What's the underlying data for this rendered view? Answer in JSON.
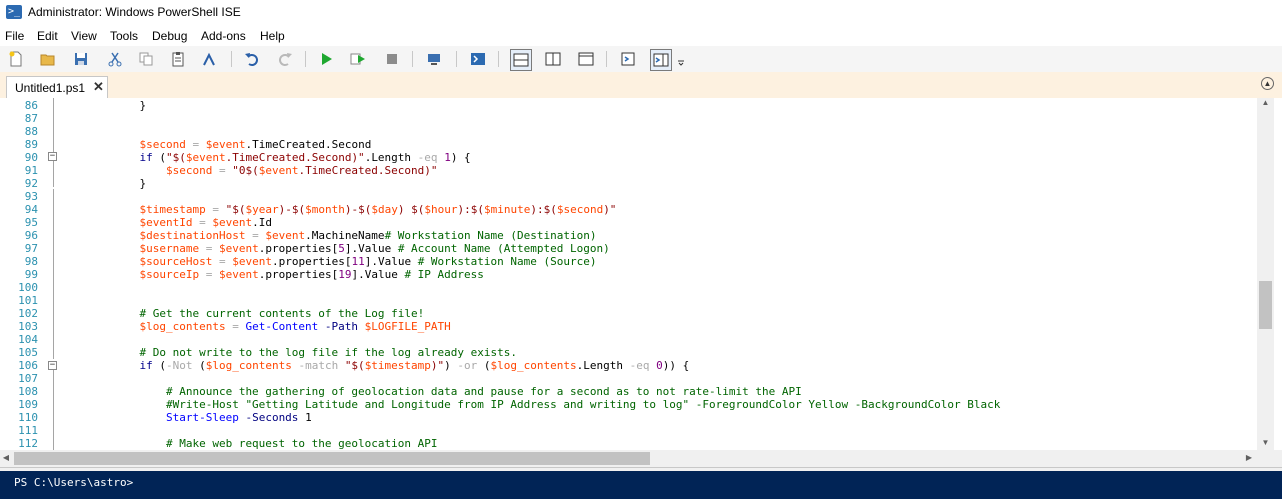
{
  "window": {
    "title": "Administrator: Windows PowerShell ISE",
    "icon": "powershell-icon"
  },
  "menu": [
    "File",
    "Edit",
    "View",
    "Tools",
    "Debug",
    "Add-ons",
    "Help"
  ],
  "toolbar": {
    "icons": [
      "new-icon",
      "open-icon",
      "save-icon",
      "cut-icon",
      "copy-icon",
      "paste-icon",
      "clear-console-icon",
      "undo-icon",
      "redo-icon",
      "run-icon",
      "run-selection-icon",
      "stop-icon",
      "remote-powershell-icon",
      "powershell-console-icon",
      "show-script-top-icon",
      "show-script-right-icon",
      "show-script-maximized-icon",
      "show-command-window-icon",
      "show-command-addon-icon",
      "more-icon"
    ]
  },
  "tabs": [
    {
      "label": "Untitled1.ps1",
      "close": "✕"
    }
  ],
  "editor": {
    "lines": [
      {
        "n": "86",
        "segs": [
          [
            "pl",
            "            }"
          ]
        ]
      },
      {
        "n": "87",
        "segs": []
      },
      {
        "n": "88",
        "segs": []
      },
      {
        "n": "89",
        "segs": [
          [
            "pl",
            "            "
          ],
          [
            "v",
            "$second"
          ],
          [
            "o",
            " = "
          ],
          [
            "v",
            "$event"
          ],
          [
            "pl",
            "."
          ],
          [
            "pl",
            "TimeCreated"
          ],
          [
            "pl",
            "."
          ],
          [
            "pl",
            "Second"
          ]
        ]
      },
      {
        "n": "90",
        "segs": [
          [
            "pl",
            "            "
          ],
          [
            "k",
            "if"
          ],
          [
            "pl",
            " ("
          ],
          [
            "s",
            "\"$("
          ],
          [
            "v",
            "$event"
          ],
          [
            "s",
            ".TimeCreated.Second)\""
          ],
          [
            "pl",
            "."
          ],
          [
            "pl",
            "Length"
          ],
          [
            "o",
            " -eq "
          ],
          [
            "n",
            "1"
          ],
          [
            "pl",
            ") {"
          ]
        ]
      },
      {
        "n": "91",
        "segs": [
          [
            "pl",
            "                "
          ],
          [
            "v",
            "$second"
          ],
          [
            "o",
            " = "
          ],
          [
            "s",
            "\"0$("
          ],
          [
            "v",
            "$event"
          ],
          [
            "s",
            ".TimeCreated.Second)\""
          ]
        ]
      },
      {
        "n": "92",
        "segs": [
          [
            "pl",
            "            }"
          ]
        ]
      },
      {
        "n": "93",
        "segs": []
      },
      {
        "n": "94",
        "segs": [
          [
            "pl",
            "            "
          ],
          [
            "v",
            "$timestamp"
          ],
          [
            "o",
            " = "
          ],
          [
            "s",
            "\"$("
          ],
          [
            "v",
            "$year"
          ],
          [
            "s",
            ")-$("
          ],
          [
            "v",
            "$month"
          ],
          [
            "s",
            ")-$("
          ],
          [
            "v",
            "$day"
          ],
          [
            "s",
            ") $("
          ],
          [
            "v",
            "$hour"
          ],
          [
            "s",
            "):$("
          ],
          [
            "v",
            "$minute"
          ],
          [
            "s",
            "):$("
          ],
          [
            "v",
            "$second"
          ],
          [
            "s",
            ")\""
          ]
        ]
      },
      {
        "n": "95",
        "segs": [
          [
            "pl",
            "            "
          ],
          [
            "v",
            "$eventId"
          ],
          [
            "o",
            " = "
          ],
          [
            "v",
            "$event"
          ],
          [
            "pl",
            ".Id"
          ]
        ]
      },
      {
        "n": "96",
        "segs": [
          [
            "pl",
            "            "
          ],
          [
            "v",
            "$destinationHost"
          ],
          [
            "o",
            " = "
          ],
          [
            "v",
            "$event"
          ],
          [
            "pl",
            ".MachineName"
          ],
          [
            "c",
            "# Workstation Name (Destination)"
          ]
        ]
      },
      {
        "n": "97",
        "segs": [
          [
            "pl",
            "            "
          ],
          [
            "v",
            "$username"
          ],
          [
            "o",
            " = "
          ],
          [
            "v",
            "$event"
          ],
          [
            "pl",
            ".properties["
          ],
          [
            "n",
            "5"
          ],
          [
            "pl",
            "].Value "
          ],
          [
            "c",
            "# Account Name (Attempted Logon)"
          ]
        ]
      },
      {
        "n": "98",
        "segs": [
          [
            "pl",
            "            "
          ],
          [
            "v",
            "$sourceHost"
          ],
          [
            "o",
            " = "
          ],
          [
            "v",
            "$event"
          ],
          [
            "pl",
            ".properties["
          ],
          [
            "n",
            "11"
          ],
          [
            "pl",
            "].Value "
          ],
          [
            "c",
            "# Workstation Name (Source)"
          ]
        ]
      },
      {
        "n": "99",
        "segs": [
          [
            "pl",
            "            "
          ],
          [
            "v",
            "$sourceIp"
          ],
          [
            "o",
            " = "
          ],
          [
            "v",
            "$event"
          ],
          [
            "pl",
            ".properties["
          ],
          [
            "n",
            "19"
          ],
          [
            "pl",
            "].Value "
          ],
          [
            "c",
            "# IP Address"
          ]
        ]
      },
      {
        "n": "100",
        "segs": []
      },
      {
        "n": "101",
        "segs": []
      },
      {
        "n": "102",
        "segs": [
          [
            "pl",
            "            "
          ],
          [
            "c",
            "# Get the current contents of the Log file!"
          ]
        ]
      },
      {
        "n": "103",
        "segs": [
          [
            "pl",
            "            "
          ],
          [
            "v",
            "$log_contents"
          ],
          [
            "o",
            " = "
          ],
          [
            "cmd",
            "Get-Content"
          ],
          [
            "p",
            " -Path "
          ],
          [
            "v",
            "$LOGFILE_PATH"
          ]
        ]
      },
      {
        "n": "104",
        "segs": []
      },
      {
        "n": "105",
        "segs": [
          [
            "pl",
            "            "
          ],
          [
            "c",
            "# Do not write to the log file if the log already exists."
          ]
        ]
      },
      {
        "n": "106",
        "segs": [
          [
            "pl",
            "            "
          ],
          [
            "k",
            "if"
          ],
          [
            "pl",
            " ("
          ],
          [
            "o",
            "-Not"
          ],
          [
            "pl",
            " ("
          ],
          [
            "v",
            "$log_contents"
          ],
          [
            "o",
            " -match "
          ],
          [
            "s",
            "\"$("
          ],
          [
            "v",
            "$timestamp"
          ],
          [
            "s",
            ")\""
          ],
          [
            "pl",
            ") "
          ],
          [
            "o",
            "-or"
          ],
          [
            "pl",
            " ("
          ],
          [
            "v",
            "$log_contents"
          ],
          [
            "pl",
            ".Length "
          ],
          [
            "o",
            "-eq "
          ],
          [
            "n",
            "0"
          ],
          [
            "pl",
            ")) {"
          ]
        ]
      },
      {
        "n": "107",
        "segs": []
      },
      {
        "n": "108",
        "segs": [
          [
            "pl",
            "                "
          ],
          [
            "c",
            "# Announce the gathering of geolocation data and pause for a second as to not rate-limit the API"
          ]
        ]
      },
      {
        "n": "109",
        "segs": [
          [
            "pl",
            "                "
          ],
          [
            "c",
            "#Write-Host \"Getting Latitude and Longitude from IP Address and writing to log\" -ForegroundColor Yellow -BackgroundColor Black"
          ]
        ]
      },
      {
        "n": "110",
        "segs": [
          [
            "pl",
            "                "
          ],
          [
            "cmd",
            "Start-Sleep"
          ],
          [
            "p",
            " -Seconds "
          ],
          [
            "pl",
            "1"
          ]
        ]
      },
      {
        "n": "111",
        "segs": []
      },
      {
        "n": "112",
        "segs": [
          [
            "pl",
            "                "
          ],
          [
            "c",
            "# Make web request to the geolocation API"
          ]
        ]
      }
    ]
  },
  "console": {
    "prompt": "PS C:\\Users\\astro>"
  },
  "colors": {
    "console_bg": "#012456",
    "tab_strip_bg": "#fdf1e0",
    "line_number": "#2b91af"
  }
}
